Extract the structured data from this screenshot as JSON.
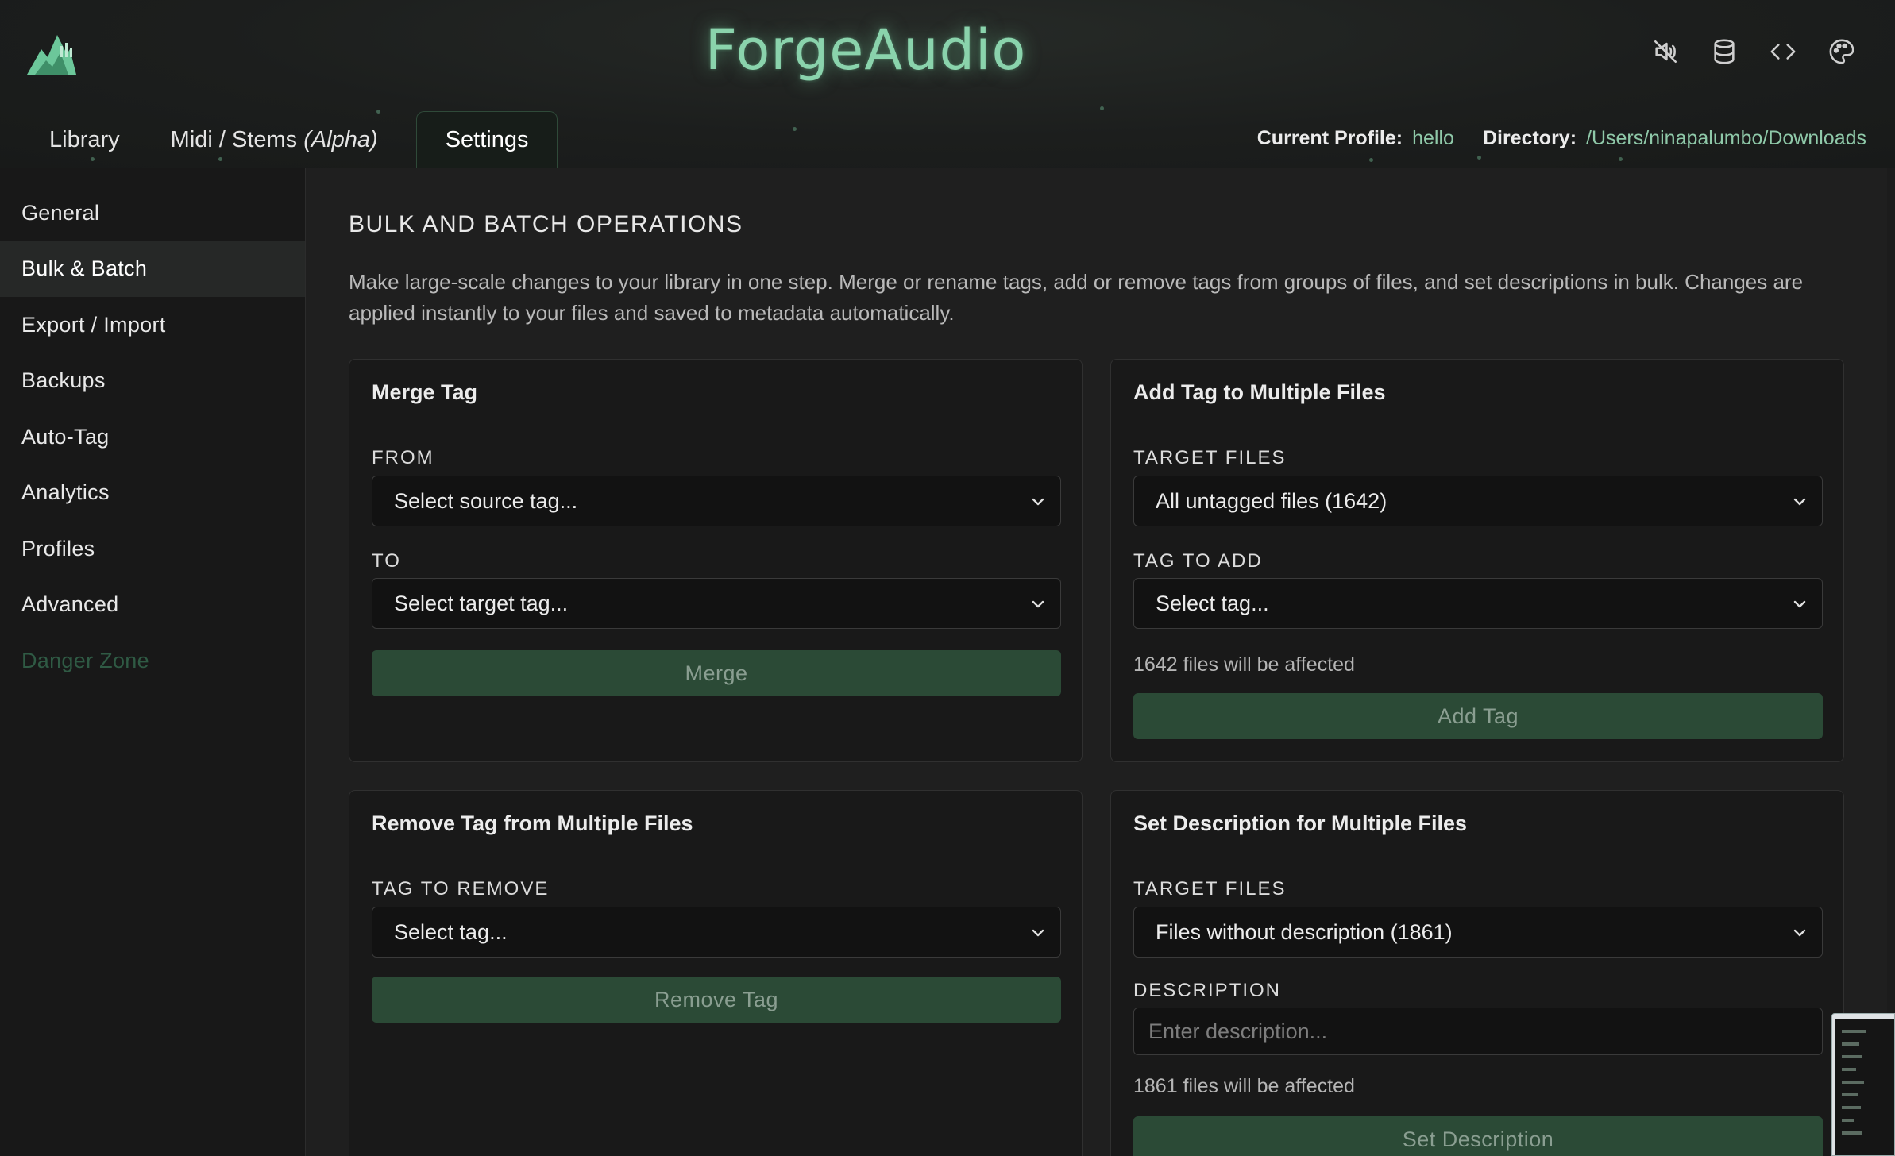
{
  "app": {
    "title": "ForgeAudio",
    "header_icons": [
      "speaker-muted-icon",
      "database-icon",
      "code-icon",
      "palette-icon"
    ]
  },
  "tabs": [
    {
      "label": "Library",
      "active": false
    },
    {
      "label": "Midi / Stems",
      "suffix": "(Alpha)",
      "active": false
    },
    {
      "label": "Settings",
      "active": true
    }
  ],
  "profile": {
    "profile_label": "Current Profile:",
    "profile_value": "hello",
    "directory_label": "Directory:",
    "directory_value": "/Users/ninapalumbo/Downloads"
  },
  "sidebar": {
    "items": [
      {
        "label": "General",
        "active": false
      },
      {
        "label": "Bulk & Batch",
        "active": true
      },
      {
        "label": "Export / Import",
        "active": false
      },
      {
        "label": "Backups",
        "active": false
      },
      {
        "label": "Auto-Tag",
        "active": false
      },
      {
        "label": "Analytics",
        "active": false
      },
      {
        "label": "Profiles",
        "active": false
      },
      {
        "label": "Advanced",
        "active": false
      },
      {
        "label": "Danger Zone",
        "active": false
      }
    ]
  },
  "main": {
    "title": "BULK AND BATCH OPERATIONS",
    "description": "Make large-scale changes to your library in one step. Merge or rename tags, add or remove tags from groups of files, and set descriptions in bulk. Changes are applied instantly to your files and saved to metadata automatically.",
    "merge": {
      "title": "Merge Tag",
      "from_label": "FROM",
      "from_value": "Select source tag...",
      "to_label": "TO",
      "to_value": "Select target tag...",
      "button": "Merge"
    },
    "add_tag": {
      "title": "Add Tag to Multiple Files",
      "target_label": "TARGET FILES",
      "target_value": "All untagged files (1642)",
      "tag_label": "TAG TO ADD",
      "tag_value": "Select tag...",
      "affected": "1642 files will be affected",
      "button": "Add Tag"
    },
    "remove_tag": {
      "title": "Remove Tag from Multiple Files",
      "tag_label": "TAG TO REMOVE",
      "tag_value": "Select tag...",
      "button": "Remove Tag"
    },
    "set_description": {
      "title": "Set Description for Multiple Files",
      "target_label": "TARGET FILES",
      "target_value": "Files without description (1861)",
      "description_label": "DESCRIPTION",
      "description_placeholder": "Enter description...",
      "affected": "1861 files will be affected",
      "button": "Set Description"
    }
  },
  "colors": {
    "accent": "#8ad3ac",
    "button_bg": "#2b4a36",
    "danger_text": "#2f5a44"
  }
}
